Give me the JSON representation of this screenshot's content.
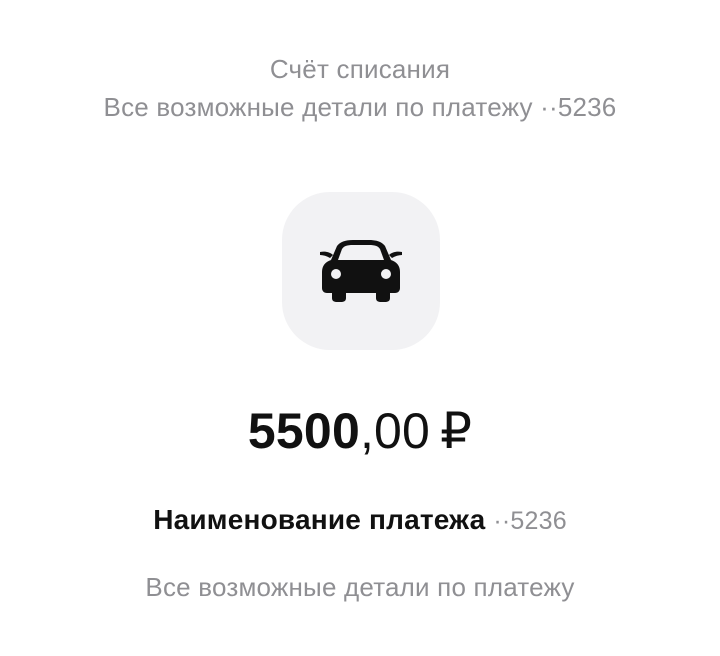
{
  "account": {
    "title": "Счёт списания",
    "subtitle": "Все возможные детали по платежу",
    "masked_number": "··5236"
  },
  "category": {
    "icon": "car-icon"
  },
  "amount": {
    "integer": "5500",
    "fraction": ",00",
    "currency": "₽"
  },
  "payment": {
    "name": "Наименование платежа",
    "masked_number": "··5236",
    "details": "Все возможные детали по платежу"
  },
  "colors": {
    "primary_text": "#111111",
    "secondary_text": "#8f8f93",
    "tile_background": "#f2f2f4",
    "icon": "#111111"
  }
}
